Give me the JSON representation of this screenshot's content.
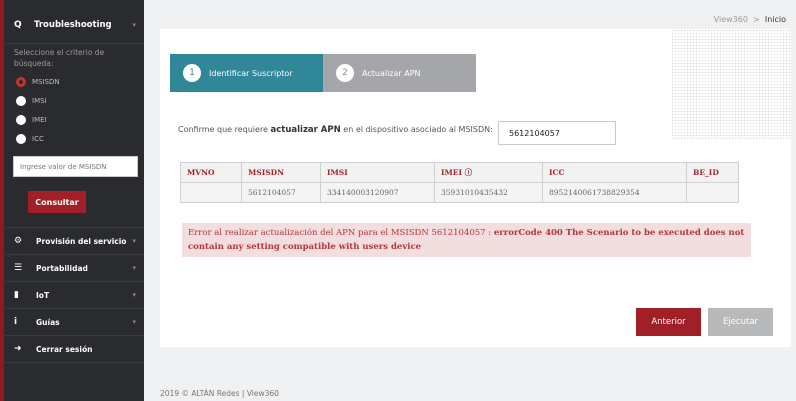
{
  "sidebar": {
    "title": "Troubleshooting",
    "search_icon": "search-icon",
    "hint": "Seleccione el criterio de búsqueda:",
    "radios": [
      {
        "label": "MSISDN",
        "selected": true
      },
      {
        "label": "IMSI",
        "selected": false
      },
      {
        "label": "IMEI",
        "selected": false
      },
      {
        "label": "ICC",
        "selected": false
      }
    ],
    "input_placeholder": "Ingrese valor de MSISDN",
    "consult_label": "Consultar",
    "menu": [
      {
        "icon": "gears-icon",
        "label": "Provisión del servicio"
      },
      {
        "icon": "sliders-icon",
        "label": "Portabilidad"
      },
      {
        "icon": "document-icon",
        "label": "IoT"
      },
      {
        "icon": "info-icon",
        "label": "Guías"
      },
      {
        "icon": "logout-icon",
        "label": "Cerrar sesión"
      }
    ]
  },
  "breadcrumb": {
    "parent": "View360",
    "separator": ">",
    "current": "Inicio"
  },
  "steps": [
    {
      "number": "1",
      "label": "Identificar Suscriptor",
      "active": true
    },
    {
      "number": "2",
      "label": "Actualizar APN",
      "active": false
    }
  ],
  "confirm": {
    "text_before": "Confirme que requiere ",
    "bold": "actualizar APN",
    "text_after": " en el dispositivo asociado al MSISDN:",
    "msisdn_value": "5612104057"
  },
  "table": {
    "headers": [
      "MVNO",
      "MSISDN",
      "IMSI",
      "IMEI ⓘ",
      "ICC",
      "BE_ID"
    ],
    "rows": [
      [
        "",
        "5612104057",
        "334140003120907",
        "35931010435432",
        "8952140061738829354",
        ""
      ]
    ]
  },
  "error": {
    "prefix": "Error al realizar actualización del APN para el MSISDN 5612104057 : ",
    "bold": "errorCode 400 The Scenario to be executed does not contain any setting compatible with users device"
  },
  "buttons": {
    "previous": "Anterior",
    "execute": "Ejecutar"
  },
  "footer": "2019 © ALTÁN Redes | View360",
  "colors": {
    "accent_red": "#a11f26",
    "step_teal": "#2f8798",
    "step_gray": "#a4a6aa",
    "sidebar_bg": "#2a2b2f"
  }
}
